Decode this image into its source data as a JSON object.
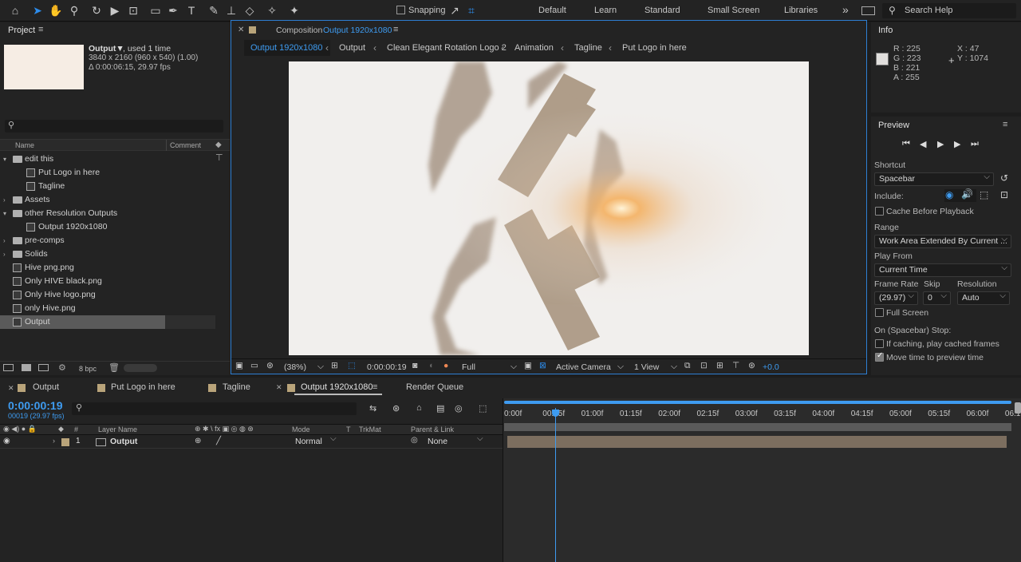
{
  "toolbar": {
    "snapping_label": "Snapping",
    "workspaces": [
      "Default",
      "Learn",
      "Standard",
      "Small Screen",
      "Libraries"
    ],
    "more": "»",
    "search_placeholder": "Search Help"
  },
  "project": {
    "title": "Project",
    "item_name": "Output▼",
    "item_used": ", used 1 time",
    "item_res": "3840 x 2160  (960 x 540) (1.00)",
    "item_dur": "Δ 0:00:06:15, 29.97 fps",
    "col_name": "Name",
    "col_comment": "Comment",
    "bpc": "8 bpc",
    "tree": [
      {
        "label": "edit this",
        "type": "folder",
        "indent": 0,
        "open": true
      },
      {
        "label": "Put Logo in here",
        "type": "comp",
        "indent": 1
      },
      {
        "label": "Tagline",
        "type": "comp",
        "indent": 1
      },
      {
        "label": "Assets",
        "type": "folder",
        "indent": 0,
        "open": false
      },
      {
        "label": "other Resolution Outputs",
        "type": "folder",
        "indent": 0,
        "open": true
      },
      {
        "label": "Output 1920x1080",
        "type": "comp",
        "indent": 1
      },
      {
        "label": "pre-comps",
        "type": "folder",
        "indent": 0,
        "open": false
      },
      {
        "label": "Solids",
        "type": "folder",
        "indent": 0,
        "open": false
      },
      {
        "label": "Hive png.png",
        "type": "file",
        "indent": 0
      },
      {
        "label": "Only HIVE black.png",
        "type": "file",
        "indent": 0
      },
      {
        "label": "Only Hive logo.png",
        "type": "file",
        "indent": 0
      },
      {
        "label": "only Hive.png",
        "type": "file",
        "indent": 0
      },
      {
        "label": "Output",
        "type": "comp",
        "indent": 0,
        "selected": true
      }
    ]
  },
  "composition": {
    "tab_prefix": "Composition",
    "tab_name": "Output 1920x1080",
    "breadcrumbs": [
      "Output 1920x1080",
      "Output",
      "Clean Elegant Rotation Logo 2",
      "Animation",
      "Tagline",
      "Put Logo in here"
    ],
    "zoom": "(38%)",
    "timecode": "0:00:00:19",
    "resolution": "Full",
    "camera": "Active Camera",
    "views": "1 View",
    "exposure": "+0.0"
  },
  "info": {
    "title": "Info",
    "r": "R :  225",
    "g": "G :  223",
    "b": "B :  221",
    "a": "A :  255",
    "x": "X :  47",
    "y": "Y :  1074"
  },
  "preview": {
    "title": "Preview",
    "shortcut_label": "Shortcut",
    "shortcut_value": "Spacebar",
    "include_label": "Include:",
    "cache_label": "Cache Before Playback",
    "range_label": "Range",
    "range_value": "Work Area Extended By Current ...",
    "playfrom_label": "Play From",
    "playfrom_value": "Current Time",
    "framerate_label": "Frame Rate",
    "skip_label": "Skip",
    "resolution_label": "Resolution",
    "framerate_value": "(29.97)",
    "skip_value": "0",
    "resolution_value": "Auto",
    "fullscreen_label": "Full Screen",
    "stop_label": "On (Spacebar) Stop:",
    "cached_label": "If caching, play cached frames",
    "move_label": "Move time to preview time"
  },
  "timeline": {
    "tabs": [
      "Output",
      "Put Logo in here",
      "Tagline",
      "Output 1920x1080",
      "Render Queue"
    ],
    "timecode": "0:00:00:19",
    "frames": "00019 (29.97 fps)",
    "col_layer": "Layer Name",
    "col_mode": "Mode",
    "col_t": "T",
    "col_trkmat": "TrkMat",
    "col_parent": "Parent & Link",
    "layer_num": "1",
    "layer_name": "Output",
    "layer_mode": "Normal",
    "layer_parent": "None",
    "ruler": [
      "0:00f",
      "00:15f",
      "01:00f",
      "01:15f",
      "02:00f",
      "02:15f",
      "03:00f",
      "03:15f",
      "04:00f",
      "04:15f",
      "05:00f",
      "05:15f",
      "06:00f",
      "06:1"
    ]
  }
}
